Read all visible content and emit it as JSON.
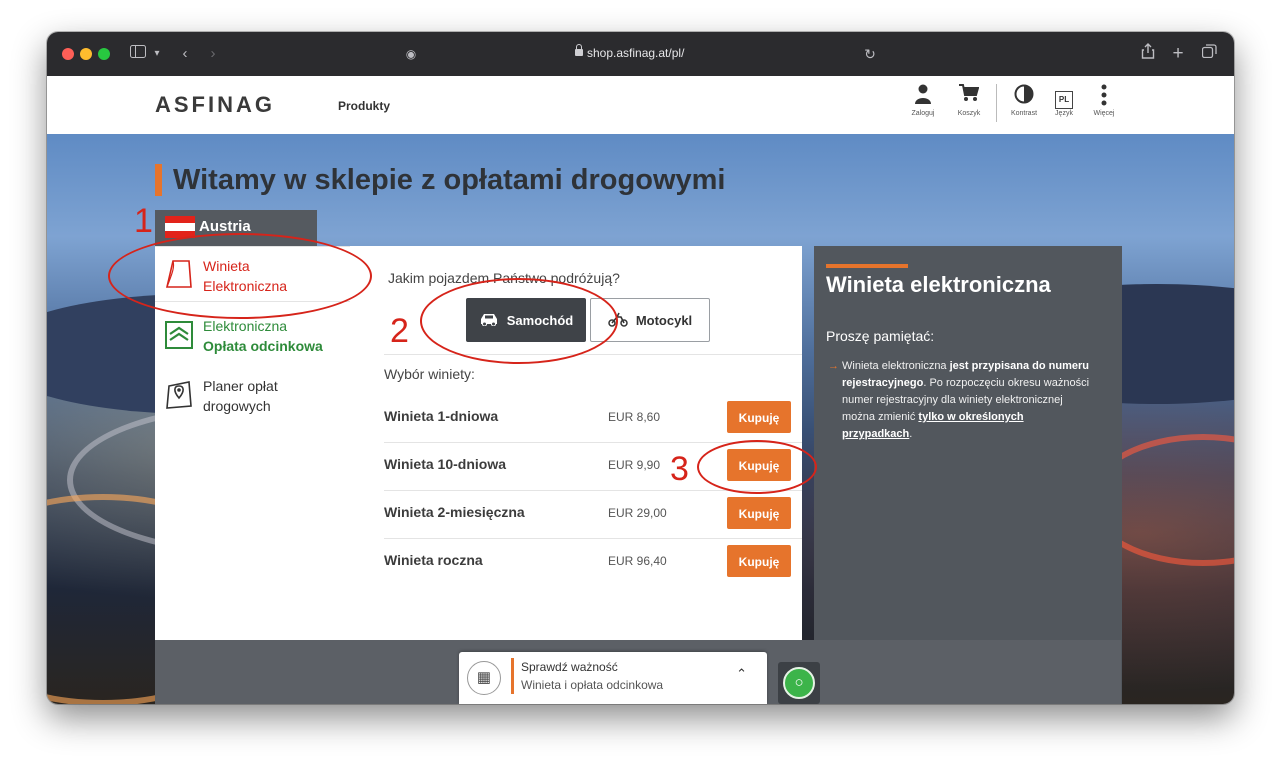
{
  "browser": {
    "url": "shop.asfinag.at/pl/"
  },
  "header": {
    "logo": "ASFINAG",
    "products_label": "Produkty",
    "actions": [
      {
        "label": "Zaloguj",
        "icon": "user-icon"
      },
      {
        "label": "Koszyk",
        "icon": "cart-icon"
      },
      {
        "label": "Kontrast",
        "icon": "contrast-icon"
      },
      {
        "label": "Język",
        "icon": "language-icon",
        "badge": "PL"
      },
      {
        "label": "Więcej",
        "icon": "more-icon"
      }
    ]
  },
  "hero": {
    "title": "Witamy w sklepie z opłatami drogowymi"
  },
  "country": {
    "name": "Austria"
  },
  "menu": {
    "items": [
      {
        "line1": "Winieta",
        "line2": "Elektroniczna",
        "icon": "vignette-icon",
        "active": true
      },
      {
        "line1": "Elektroniczna",
        "line2": "Opłata odcinkowa",
        "icon": "section-toll-icon",
        "active": false
      },
      {
        "line1": "Planer opłat",
        "line2": "drogowych",
        "icon": "map-pin-icon",
        "active": false
      }
    ]
  },
  "main": {
    "question": "Jakim pojazdem Państwo podróżują?",
    "vehicles": [
      {
        "label": "Samochód",
        "icon": "car-icon",
        "selected": true
      },
      {
        "label": "Motocykl",
        "icon": "motorcycle-icon",
        "selected": false
      }
    ],
    "choose_label": "Wybór winiety:",
    "buy_label": "Kupuję",
    "vignettes": [
      {
        "name": "Winieta 1-dniowa",
        "price": "EUR 8,60"
      },
      {
        "name": "Winieta 10-dniowa",
        "price": "EUR 9,90"
      },
      {
        "name": "Winieta 2-miesięczna",
        "price": "EUR 29,00"
      },
      {
        "name": "Winieta roczna",
        "price": "EUR 96,40"
      }
    ]
  },
  "info": {
    "title": "Winieta elektroniczna",
    "subtitle": "Proszę pamiętać:",
    "text_1": "Winieta elektroniczna ",
    "text_bold_1": "jest przypisana do numeru rejestracyjnego",
    "text_2": ". Po rozpoczęciu okresu ważności numer rejestracyjny dla winiety elektronicznej można zmienić ",
    "text_link": "tylko w określonych przypadkach",
    "text_3": "."
  },
  "check_card": {
    "title": "Sprawdź ważność",
    "subtitle": "Winieta i opłata odcinkowa"
  },
  "annotations": [
    "1",
    "2",
    "3"
  ],
  "colors": {
    "accent": "#e6742c",
    "annotation": "#d6241a",
    "panel_dark": "#52575d"
  }
}
